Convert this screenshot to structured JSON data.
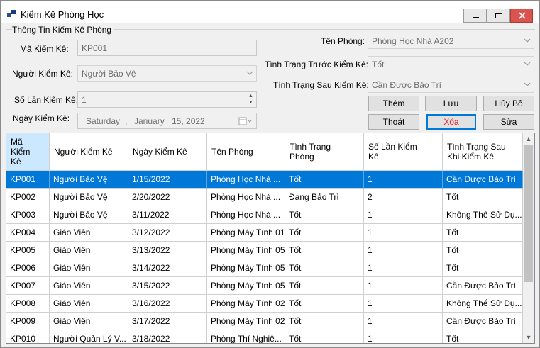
{
  "window": {
    "title": "Kiểm Kê Phòng Học",
    "minimize_label": "—",
    "maximize_label": "☐",
    "close_label": "✕"
  },
  "form": {
    "group_title": "Thông Tin Kiểm Kê Phòng",
    "ma_kiem_ke": {
      "label": "Mã Kiểm Kê:",
      "value": "KP001"
    },
    "nguoi_kiem_ke": {
      "label": "Người Kiểm Kê:",
      "value": "Người Bảo Vệ"
    },
    "so_lan_kiem_ke": {
      "label": "Số Lần Kiểm Kê:",
      "value": "1"
    },
    "ngay_kiem_ke": {
      "label": "Ngày Kiểm Kê:",
      "day_name": "Saturday",
      "sep": ",",
      "month": "January",
      "day_year": "15, 2022"
    },
    "ten_phong": {
      "label": "Tên Phòng:",
      "value": "Phòng Học Nhà A202"
    },
    "tinh_trang_truoc": {
      "label": "Tình Trạng Trước Kiểm Kê:",
      "value": "Tốt"
    },
    "tinh_trang_sau": {
      "label": "Tình Trạng Sau Kiểm Kê:",
      "value": "Cần Được Bảo Trì"
    }
  },
  "buttons": {
    "them": "Thêm",
    "luu": "Lưu",
    "huy_bo": "Hủy Bỏ",
    "thoat": "Thoát",
    "xoa": "Xóa",
    "sua": "Sửa"
  },
  "table": {
    "columns": [
      "Mã\nKiểm\nKê",
      "Người Kiểm Kê",
      "Ngày Kiểm Kê",
      "Tên Phòng",
      "Tình Trạng\nPhòng",
      "Số Lần Kiểm\nKê",
      "Tình Trạng Sau\nKhi Kiểm Kê"
    ],
    "rows": [
      [
        "KP001",
        "Người Bảo Vệ",
        "1/15/2022",
        "Phòng Học Nhà ...",
        "Tốt",
        "1",
        "Cần Được Bảo Trì"
      ],
      [
        "KP002",
        "Người Bảo Vệ",
        "2/20/2022",
        "Phòng Học Nhà ...",
        "Đang Bảo Trì",
        "2",
        "Tốt"
      ],
      [
        "KP003",
        "Người Bảo Vệ",
        "3/11/2022",
        "Phòng Học Nhà ...",
        "Tốt",
        "1",
        "Không Thể Sử Dụ..."
      ],
      [
        "KP004",
        "Giáo Viên",
        "3/12/2022",
        "Phòng Máy Tính 01",
        "Tốt",
        "1",
        "Tốt"
      ],
      [
        "KP005",
        "Giáo Viên",
        "3/13/2022",
        "Phòng Máy Tính 05",
        "Tốt",
        "1",
        "Tốt"
      ],
      [
        "KP006",
        "Giáo Viên",
        "3/14/2022",
        "Phòng Máy Tính 05",
        "Tốt",
        "1",
        "Tốt"
      ],
      [
        "KP007",
        "Giáo Viên",
        "3/15/2022",
        "Phòng Máy Tính 05",
        "Tốt",
        "1",
        "Cần Được Bảo Trì"
      ],
      [
        "KP008",
        "Giáo Viên",
        "3/16/2022",
        "Phòng Máy Tính 02",
        "Tốt",
        "1",
        "Không Thể Sử Dụ..."
      ],
      [
        "KP009",
        "Giáo Viên",
        "3/17/2022",
        "Phòng Máy Tính 02",
        "Tốt",
        "1",
        "Cần Được Bảo Trì"
      ],
      [
        "KP010",
        "Người Quản Lý V...",
        "3/18/2022",
        "Phòng Thí Nghiệ...",
        "Tốt",
        "1",
        "Tốt"
      ]
    ],
    "selected_row": 0
  },
  "icons": {
    "dropdown": "chevron-down-icon",
    "calendar": "calendar-icon",
    "spin": "spin-updown-icon"
  },
  "colors": {
    "selection": "#0078d7",
    "header_selected": "#cce8ff",
    "delete_text": "#e02020",
    "close_button": "#d9534f"
  }
}
